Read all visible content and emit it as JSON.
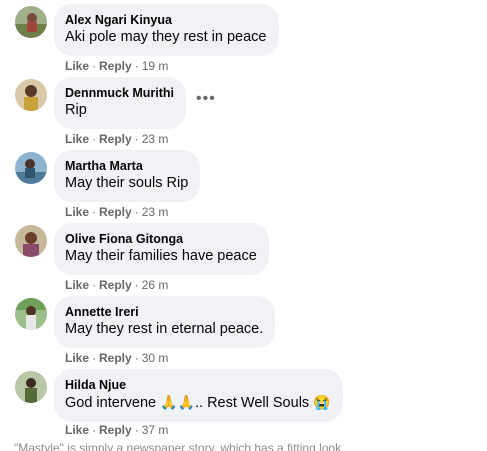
{
  "comments": [
    {
      "author": "Alex Ngari Kinyua",
      "text": "Aki pole may they rest in peace",
      "like": "Like",
      "reply": "Reply",
      "time": "19 m"
    },
    {
      "author": "Dennmuck Murithi",
      "text": "Rip",
      "like": "Like",
      "reply": "Reply",
      "time": "23 m",
      "more_icon": "more-options-icon"
    },
    {
      "author": "Martha Marta",
      "text": "May their souls Rip",
      "like": "Like",
      "reply": "Reply",
      "time": "23 m"
    },
    {
      "author": "Olive Fiona Gitonga",
      "text": "May their families have peace",
      "like": "Like",
      "reply": "Reply",
      "time": "26 m"
    },
    {
      "author": "Annette Ireri",
      "text": "May they rest in eternal peace.",
      "like": "Like",
      "reply": "Reply",
      "time": "30 m"
    },
    {
      "author": "Hilda Njue",
      "text_before": "God intervene ",
      "emoji_hands": "🙏🙏",
      "text_after": ".. Rest Well Souls ",
      "emoji_cry": "😭",
      "like": "Like",
      "reply": "Reply",
      "time": "37 m"
    }
  ],
  "separator": "·",
  "truncated_text": "\"Mastyle\" is simply a newspaper story, which has a fitting look",
  "colors": {
    "bubble": "#f0f2f5",
    "secondary_text": "#65676b",
    "primary_text": "#050505"
  }
}
